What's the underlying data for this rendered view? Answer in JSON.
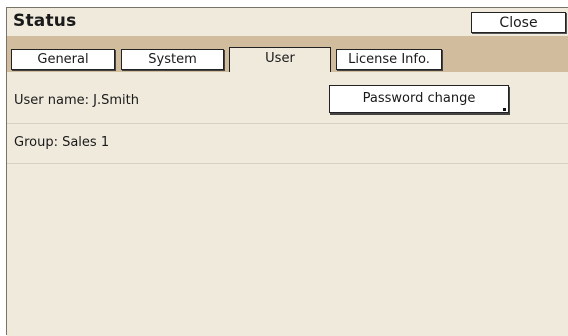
{
  "window": {
    "title": "Status",
    "close_label": "Close"
  },
  "tabs": [
    {
      "label": "General",
      "active": false
    },
    {
      "label": "System",
      "active": false
    },
    {
      "label": "User",
      "active": true
    },
    {
      "label": "License Info.",
      "active": false
    }
  ],
  "user": {
    "username_text": "User name: J.Smith",
    "group_text": "Group: Sales 1",
    "password_change_label": "Password change"
  },
  "colors": {
    "panel_bg": "#efeadc",
    "tabstrip_bg": "#d2bc9e",
    "button_bg": "#ffffff"
  }
}
